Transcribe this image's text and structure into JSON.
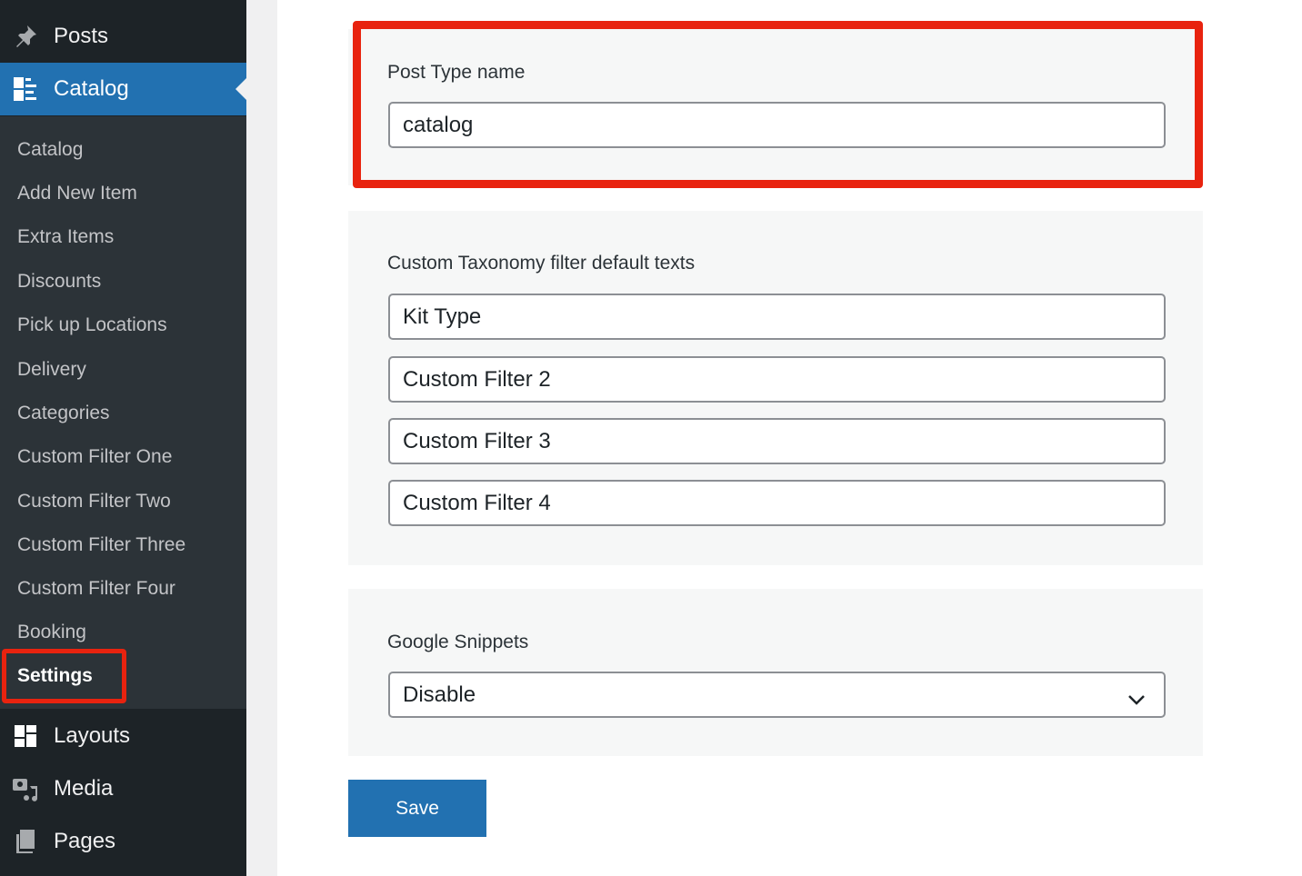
{
  "sidebar": {
    "posts": "Posts",
    "catalog": "Catalog",
    "submenu": [
      "Catalog",
      "Add New Item",
      "Extra Items",
      "Discounts",
      "Pick up Locations",
      "Delivery",
      "Categories",
      "Custom Filter One",
      "Custom Filter Two",
      "Custom Filter Three",
      "Custom Filter Four",
      "Booking",
      "Settings"
    ],
    "layouts": "Layouts",
    "media": "Media",
    "pages": "Pages"
  },
  "main": {
    "post_type": {
      "label": "Post Type name",
      "value": "catalog"
    },
    "taxonomy": {
      "label": "Custom Taxonomy filter default texts",
      "values": [
        "Kit Type",
        "Custom Filter 2",
        "Custom Filter 3",
        "Custom Filter 4"
      ]
    },
    "snippets": {
      "label": "Google Snippets",
      "selected": "Disable"
    },
    "save_label": "Save"
  },
  "colors": {
    "accent": "#2271b1",
    "highlight": "#e8230f",
    "sidebar": "#1d2327"
  }
}
